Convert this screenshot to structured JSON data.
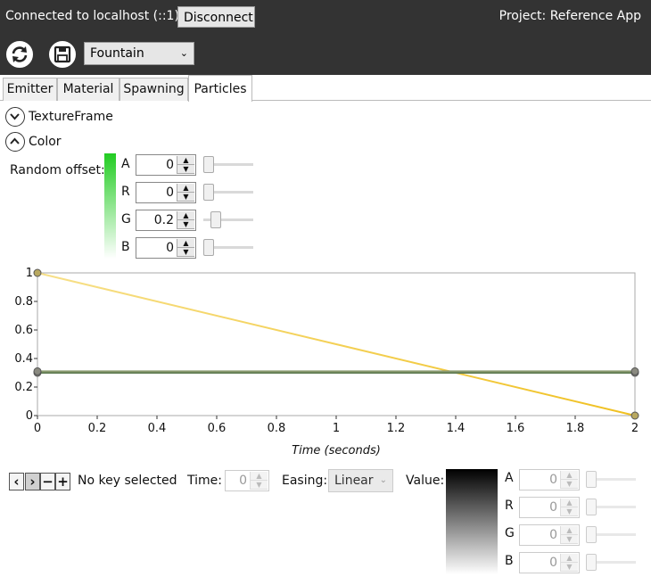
{
  "header": {
    "connection": "Connected to localhost (::1)",
    "disconnect_label": "Disconnect",
    "project": "Project: Reference App"
  },
  "toolbar": {
    "refresh_icon": "refresh-icon",
    "save_icon": "save-icon",
    "preset": "Fountain"
  },
  "tabs": [
    {
      "label": "Emitter",
      "active": false
    },
    {
      "label": "Material",
      "active": false
    },
    {
      "label": "Spawning",
      "active": false
    },
    {
      "label": "Particles",
      "active": true
    }
  ],
  "sections": {
    "texture_frame": "TextureFrame",
    "color": "Color"
  },
  "random_offset": {
    "label": "Random offset:",
    "gradient_color": "#22cc22",
    "channels": [
      {
        "name": "A",
        "value": "0",
        "slider": 0
      },
      {
        "name": "R",
        "value": "0",
        "slider": 0
      },
      {
        "name": "G",
        "value": "0.2",
        "slider": 0.2
      },
      {
        "name": "B",
        "value": "0",
        "slider": 0
      }
    ]
  },
  "chart_data": {
    "type": "line",
    "xlabel": "Time (seconds)",
    "ylabel": "",
    "xlim": [
      0,
      2
    ],
    "ylim": [
      0,
      1
    ],
    "x_ticks": [
      "0",
      "0.2",
      "0.4",
      "0.6",
      "0.8",
      "1",
      "1.2",
      "1.4",
      "1.6",
      "1.8",
      "2"
    ],
    "y_ticks": [
      "0",
      "0.2",
      "0.4",
      "0.6",
      "0.8",
      "1"
    ],
    "series": [
      {
        "x": [
          0,
          2
        ],
        "y": [
          1,
          0
        ],
        "color": "#f0c020"
      },
      {
        "x": [
          0,
          2
        ],
        "y": [
          0.3,
          0.3
        ],
        "color": "#5e7a50"
      },
      {
        "x": [
          0,
          2
        ],
        "y": [
          0.31,
          0.31
        ],
        "color": "#8a9a70"
      }
    ]
  },
  "key_editor": {
    "status": "No key selected",
    "time_label": "Time:",
    "time_value": "0",
    "easing_label": "Easing:",
    "easing_value": "Linear",
    "value_label": "Value:",
    "channels": [
      {
        "name": "A",
        "value": "0"
      },
      {
        "name": "R",
        "value": "0"
      },
      {
        "name": "G",
        "value": "0"
      },
      {
        "name": "B",
        "value": "0"
      }
    ]
  }
}
